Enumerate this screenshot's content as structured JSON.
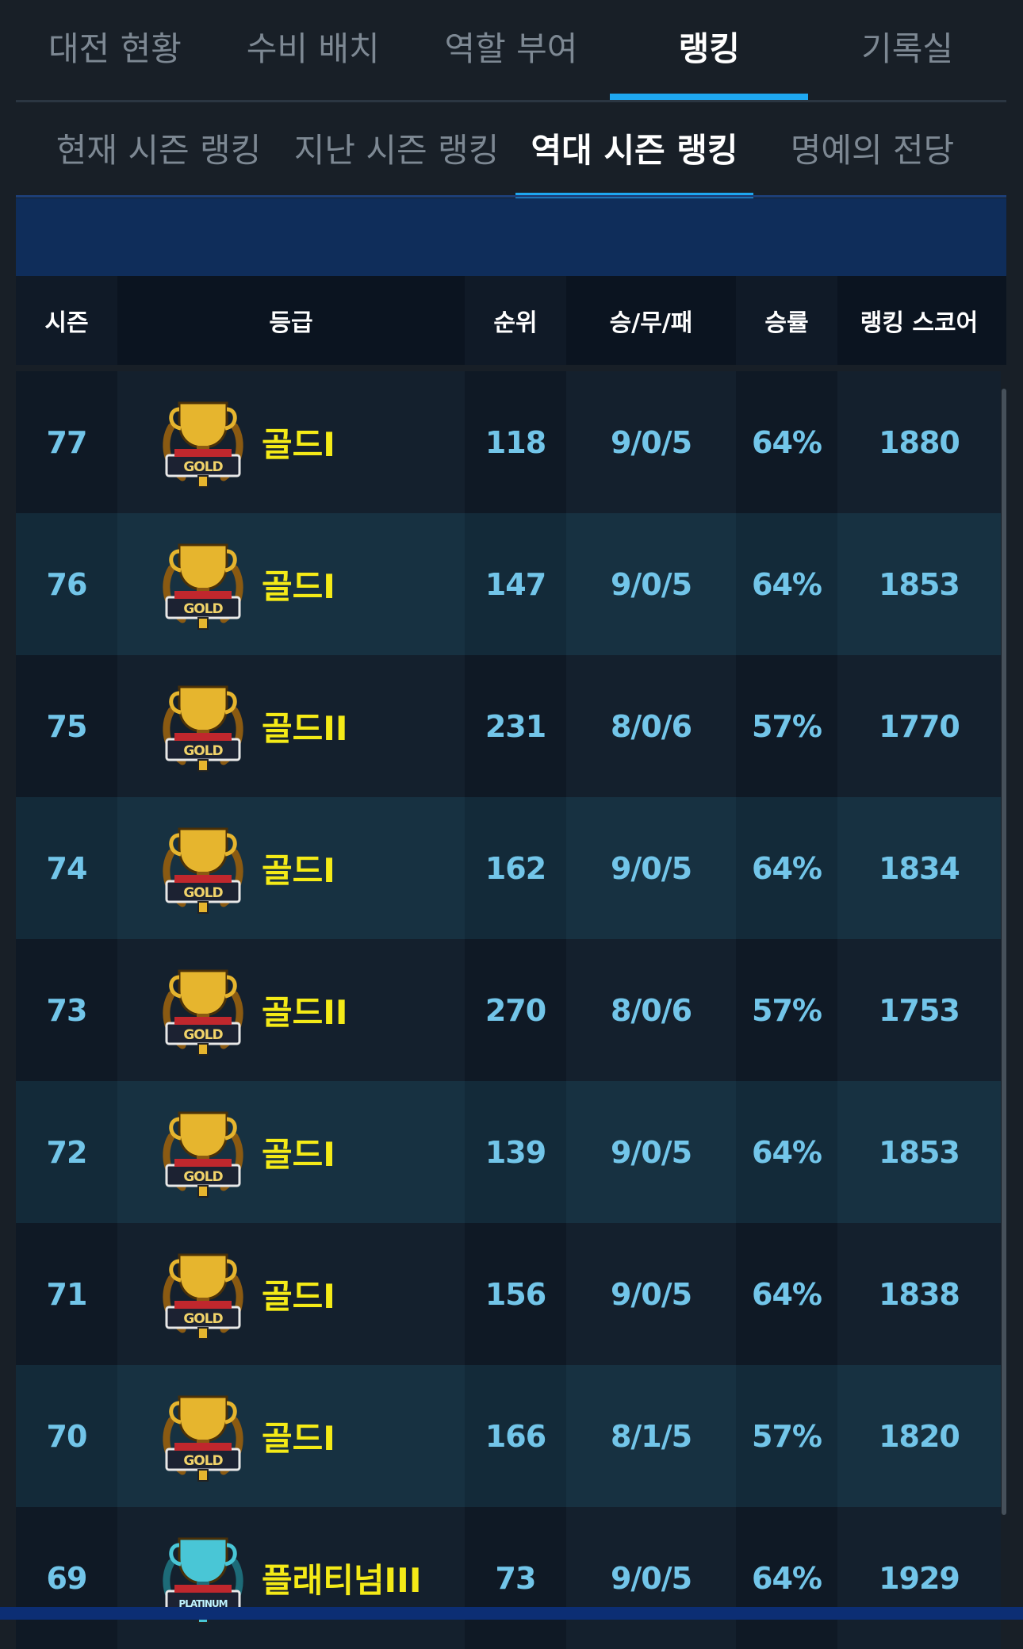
{
  "top_tabs": [
    "대전 현황",
    "수비 배치",
    "역할 부여",
    "랭킹",
    "기록실"
  ],
  "top_active": "랭킹",
  "sub_tabs": [
    "현재 시즌 랭킹",
    "지난 시즌 랭킹",
    "역대 시즌 랭킹",
    "명예의 전당"
  ],
  "sub_active": "역대 시즌 랭킹",
  "table": {
    "headers": {
      "season": "시즌",
      "grade": "등급",
      "rank": "순위",
      "record": "승/무/패",
      "winrate": "승률",
      "score": "랭킹 스코어"
    },
    "rows": [
      {
        "season": "77",
        "badge": "gold-trophy-icon",
        "grade": "골드I",
        "rank": "118",
        "record": "9/0/5",
        "winrate": "64%",
        "score": "1880"
      },
      {
        "season": "76",
        "badge": "gold-trophy-icon",
        "grade": "골드I",
        "rank": "147",
        "record": "9/0/5",
        "winrate": "64%",
        "score": "1853"
      },
      {
        "season": "75",
        "badge": "gold-trophy-icon",
        "grade": "골드II",
        "rank": "231",
        "record": "8/0/6",
        "winrate": "57%",
        "score": "1770"
      },
      {
        "season": "74",
        "badge": "gold-trophy-icon",
        "grade": "골드I",
        "rank": "162",
        "record": "9/0/5",
        "winrate": "64%",
        "score": "1834"
      },
      {
        "season": "73",
        "badge": "gold-trophy-icon",
        "grade": "골드II",
        "rank": "270",
        "record": "8/0/6",
        "winrate": "57%",
        "score": "1753"
      },
      {
        "season": "72",
        "badge": "gold-trophy-icon",
        "grade": "골드I",
        "rank": "139",
        "record": "9/0/5",
        "winrate": "64%",
        "score": "1853"
      },
      {
        "season": "71",
        "badge": "gold-trophy-icon",
        "grade": "골드I",
        "rank": "156",
        "record": "9/0/5",
        "winrate": "64%",
        "score": "1838"
      },
      {
        "season": "70",
        "badge": "gold-trophy-icon",
        "grade": "골드I",
        "rank": "166",
        "record": "8/1/5",
        "winrate": "57%",
        "score": "1820"
      },
      {
        "season": "69",
        "badge": "platinum-trophy-icon",
        "grade": "플래티넘III",
        "rank": "73",
        "record": "9/0/5",
        "winrate": "64%",
        "score": "1929"
      }
    ]
  },
  "badge_text": {
    "gold": "GOLD",
    "platinum": "PLATINUM"
  },
  "colors": {
    "accent": "#1ea7f0",
    "grade_text": "#f4ea17",
    "cell_text": "#72c5e9",
    "gold": "#e6b52e",
    "platinum": "#49c6d6"
  }
}
